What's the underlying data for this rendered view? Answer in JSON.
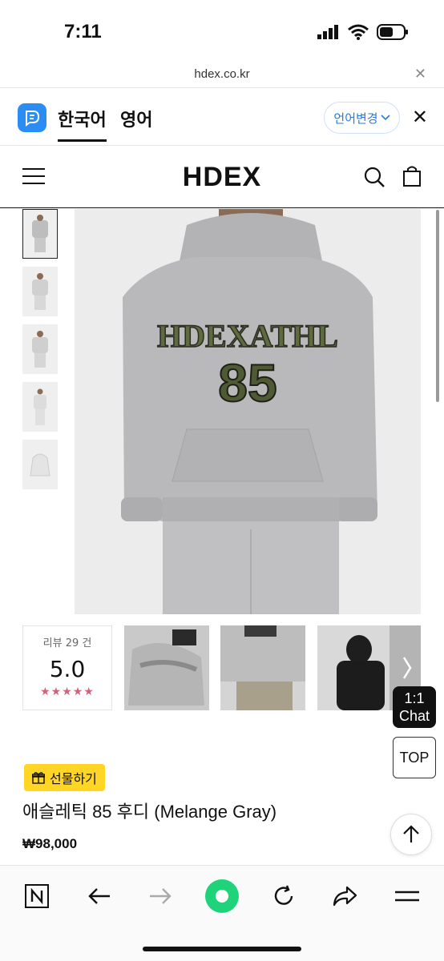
{
  "status_bar": {
    "time": "7:11"
  },
  "browser": {
    "url": "hdex.co.kr"
  },
  "language_bar": {
    "tabs": [
      "한국어",
      "영어"
    ],
    "change_button": "언어변경"
  },
  "site_header": {
    "brand": "HDEX"
  },
  "product_image": {
    "hoodie_print_line1": "HDEXATHL",
    "hoodie_print_line2": "85",
    "colors": {
      "hoodie": "#b9b9bb",
      "background": "#ececec"
    }
  },
  "reviews": {
    "label": "리뷰 29 건",
    "score": "5.0",
    "stars": "★★★★★"
  },
  "floating": {
    "chat_line1": "1:1",
    "chat_line2": "Chat",
    "top_label": "TOP"
  },
  "product": {
    "gift_label": "선물하기",
    "name": "애슬레틱 85 후디 (Melange Gray)",
    "price": "₩98,000"
  },
  "colors": {
    "accent_blue": "#2b8cf4",
    "gift_yellow": "#ffd526",
    "star_pink": "#d2627a",
    "browser_green": "#1fd37a"
  }
}
